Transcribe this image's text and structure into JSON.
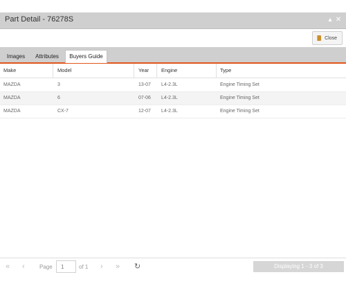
{
  "window": {
    "title": "Part Detail - 76278S",
    "minimize_glyph": "▴",
    "close_glyph": "✕"
  },
  "toolbar": {
    "close_label": "Close",
    "close_icon": "door-icon"
  },
  "tabs": [
    {
      "label": "Images",
      "active": false
    },
    {
      "label": "Attributes",
      "active": false
    },
    {
      "label": "Buyers Guide",
      "active": true
    }
  ],
  "grid": {
    "columns": [
      "Make",
      "Model",
      "Year",
      "Engine",
      "Type"
    ],
    "rows": [
      [
        "MAZDA",
        "3",
        "13-07",
        "L4-2.3L",
        "Engine Timing Set"
      ],
      [
        "MAZDA",
        "6",
        "07-06",
        "L4-2.3L",
        "Engine Timing Set"
      ],
      [
        "MAZDA",
        "CX-7",
        "12-07",
        "L4-2.3L",
        "Engine Timing Set"
      ]
    ]
  },
  "pager": {
    "first_glyph": "«",
    "prev_glyph": "‹",
    "page_label": "Page",
    "page_value": "1",
    "of_label": "of 1",
    "next_glyph": "›",
    "last_glyph": "»",
    "refresh_glyph": "↻",
    "display_text": "Displaying 1 - 3 of 3"
  },
  "colors": {
    "accent": "#e2541b",
    "titlebar": "#cfcfcf"
  }
}
